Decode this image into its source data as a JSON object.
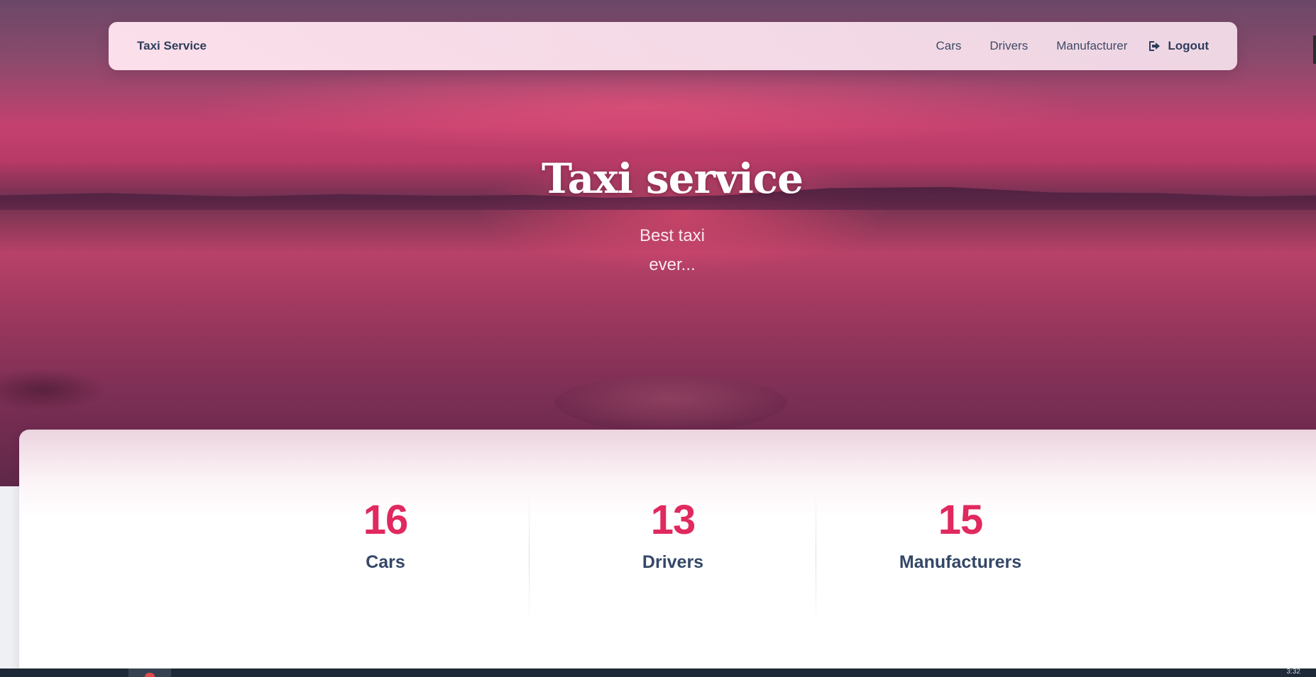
{
  "navbar": {
    "brand": "Taxi Service",
    "links": [
      "Cars",
      "Drivers",
      "Manufacturer"
    ],
    "logout_label": "Logout",
    "logout_icon": "sign-out-icon"
  },
  "hero": {
    "title": "Taxi service",
    "subtitle_line1": "Best taxi",
    "subtitle_line2": "ever..."
  },
  "stats": [
    {
      "value": "16",
      "label": "Cars"
    },
    {
      "value": "13",
      "label": "Drivers"
    },
    {
      "value": "15",
      "label": "Manufacturers"
    }
  ],
  "taskbar": {
    "time": "3:32"
  },
  "colors": {
    "accent": "#e0295f",
    "text_dark": "#344767",
    "hero_tint": "#b83a66"
  }
}
